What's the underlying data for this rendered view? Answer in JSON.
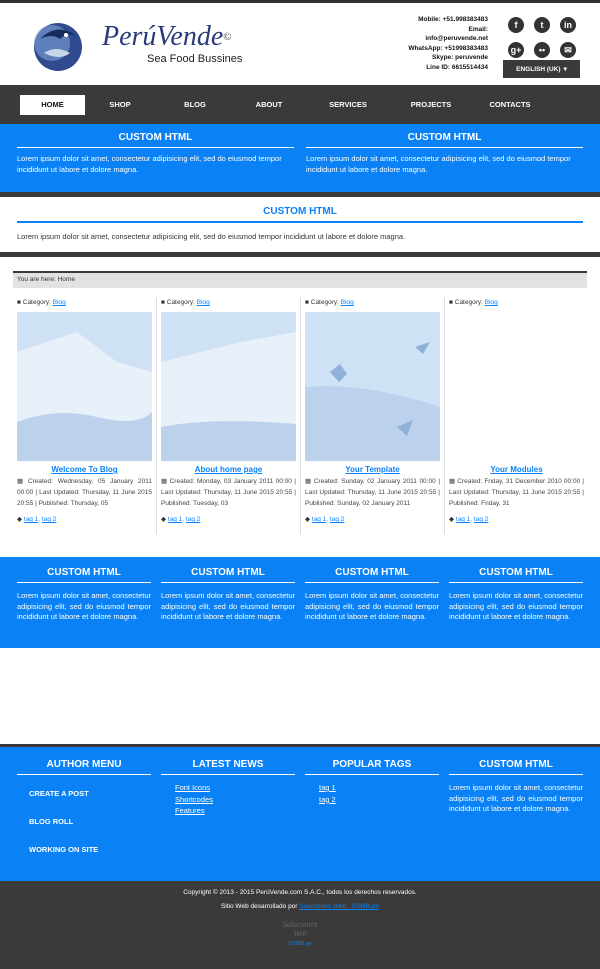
{
  "brand": {
    "name": "PerúVende",
    "copyright_mark": "©",
    "slogan": "Sea Food Bussines"
  },
  "contact": {
    "lines": [
      "Mobile: +51.998383483",
      "Email:",
      "info@peruvende.net",
      "WhatsApp: +51998383483",
      "Skype: peruvende",
      "Line ID: 6615514434"
    ]
  },
  "social": {
    "icons": [
      "facebook-icon",
      "tumblr-icon",
      "linkedin-icon",
      "google-plus-icon",
      "flickr-icon",
      "email-icon"
    ],
    "glyphs": [
      "f",
      "t",
      "in",
      "g+",
      "••",
      "✉"
    ]
  },
  "language": {
    "label": "ENGLISH (UK)",
    "caret": "▾"
  },
  "nav": {
    "items": [
      "HOME",
      "SHOP",
      "BLOG",
      "ABOUT",
      "SERVICES",
      "PROJECTS",
      "CONTACTS"
    ]
  },
  "top_modules": [
    {
      "title": "CUSTOM HTML",
      "text": "Lorem ipsum dolor sit amet, consectetur adipisicing elit, sed do eiusmod tempor incididunt ut labore et dolore magna."
    },
    {
      "title": "CUSTOM HTML",
      "text": "Lorem ipsum dolor sit amet, consectetur adipisicing elit, sed do eiusmod tempor incididunt ut labore et dolore magna."
    }
  ],
  "wide_module": {
    "title": "CUSTOM HTML",
    "text": "Lorem ipsum dolor sit amet, consectetur adipisicing elit, sed do eiusmod tempor incididunt ut labore et dolore magna."
  },
  "breadcrumb": {
    "text": "You are here:  Home"
  },
  "articles": [
    {
      "category_label": "Category:",
      "category": "Blog",
      "title": "Welcome To Blog",
      "meta": "Created: Wednesday, 05 January 2011 00:00 | Last Updated: Thursday, 11 June 2015 20:55 | Published: Thursday, 05",
      "tags": [
        "tag 1",
        "tag 2"
      ]
    },
    {
      "category_label": "Category:",
      "category": "Blog",
      "title": "About home page",
      "meta": "Created: Monday, 03 January 2011 00:00 | Last Updated: Thursday, 11 June 2015 20:55 | Published: Tuesday, 03",
      "tags": [
        "tag 1",
        "tag 2"
      ]
    },
    {
      "category_label": "Category:",
      "category": "Blog",
      "title": "Your Template",
      "meta": "Created: Sunday, 02 January 2011 00:00 | Last Updated: Thursday, 11 June 2015 20:55 | Published: Sunday, 02 January 2011",
      "tags": [
        "tag 1",
        "tag 2"
      ]
    },
    {
      "category_label": "Category:",
      "category": "Blog",
      "title": "Your Modules",
      "meta": "Created: Friday, 31 December 2010 00:00 | Last Updated: Thursday, 11 June 2015 20:55 | Published: Friday, 31",
      "tags": [
        "tag 1",
        "tag 2"
      ]
    }
  ],
  "bottom_modules": [
    {
      "title": "CUSTOM HTML",
      "text": "Lorem ipsum dolor sit amet, consectetur adipisicing elit, sed do eiusmod tempor incididunt ut labore et dolore magna."
    },
    {
      "title": "CUSTOM HTML",
      "text": "Lorem ipsum dolor sit amet, consectetur adipisicing elit, sed do eiusmod tempor incididunt ut labore et dolore magna."
    },
    {
      "title": "CUSTOM HTML",
      "text": "Lorem ipsum dolor sit amet, consectetur adipisicing elit, sed do eiusmod tempor incididunt ut labore et dolore magna."
    },
    {
      "title": "CUSTOM HTML",
      "text": "Lorem ipsum dolor sit amet, consectetur adipisicing elit, sed do eiusmod tempor incididunt ut labore et dolore magna."
    }
  ],
  "footer": {
    "author_menu": {
      "title": "AUTHOR MENU",
      "items": [
        "CREATE A POST",
        "BLOG ROLL",
        "WORKING ON SITE"
      ]
    },
    "latest_news": {
      "title": "LATEST NEWS",
      "items": [
        "Font Icons",
        "Shortcodes",
        "Features"
      ]
    },
    "popular_tags": {
      "title": "POPULAR TAGS",
      "items": [
        "tag 1",
        "tag 2"
      ]
    },
    "custom": {
      "title": "CUSTOM HTML",
      "text": "Lorem ipsum dolor sit amet, consectetur adipisicing elit, sed do eiusmod tempor incididunt ut labore et dolore magna."
    }
  },
  "copyright": {
    "line1": "Copyright © 2013 - 2015 PerúVende.com S.A.C., todos los derechos reservados.",
    "line2_prefix": "Sitio Web desarrollado por ",
    "line2_link": "Soluciones Web : SSMB.pe",
    "mark_line1": "Soluciones",
    "mark_line2": "Web",
    "mark_small": "SSMB.pe"
  },
  "colors": {
    "accent": "#0a82f5",
    "dark": "#3a3a3a",
    "image_placeholder": "#cfe1f5"
  }
}
